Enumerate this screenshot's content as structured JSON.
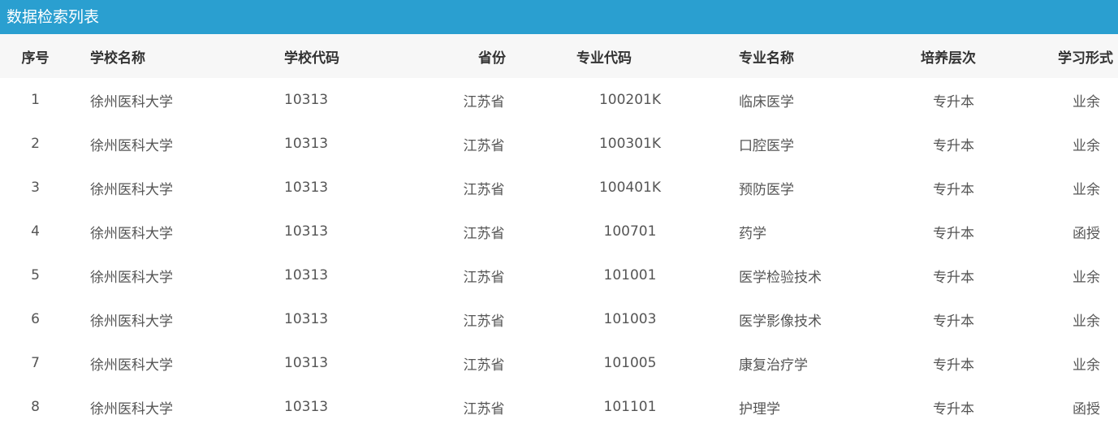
{
  "header": {
    "title": "数据检索列表",
    "bg_color": "#2a9fd0"
  },
  "table": {
    "columns": [
      "序号",
      "学校名称",
      "学校代码",
      "省份",
      "专业代码",
      "专业名称",
      "培养层次",
      "学习形式"
    ],
    "rows": [
      [
        "1",
        "徐州医科大学",
        "10313",
        "江苏省",
        "100201K",
        "临床医学",
        "专升本",
        "业余"
      ],
      [
        "2",
        "徐州医科大学",
        "10313",
        "江苏省",
        "100301K",
        "口腔医学",
        "专升本",
        "业余"
      ],
      [
        "3",
        "徐州医科大学",
        "10313",
        "江苏省",
        "100401K",
        "预防医学",
        "专升本",
        "业余"
      ],
      [
        "4",
        "徐州医科大学",
        "10313",
        "江苏省",
        "100701",
        "药学",
        "专升本",
        "函授"
      ],
      [
        "5",
        "徐州医科大学",
        "10313",
        "江苏省",
        "101001",
        "医学检验技术",
        "专升本",
        "业余"
      ],
      [
        "6",
        "徐州医科大学",
        "10313",
        "江苏省",
        "101003",
        "医学影像技术",
        "专升本",
        "业余"
      ],
      [
        "7",
        "徐州医科大学",
        "10313",
        "江苏省",
        "101005",
        "康复治疗学",
        "专升本",
        "业余"
      ],
      [
        "8",
        "徐州医科大学",
        "10313",
        "江苏省",
        "101101",
        "护理学",
        "专升本",
        "函授"
      ]
    ]
  }
}
